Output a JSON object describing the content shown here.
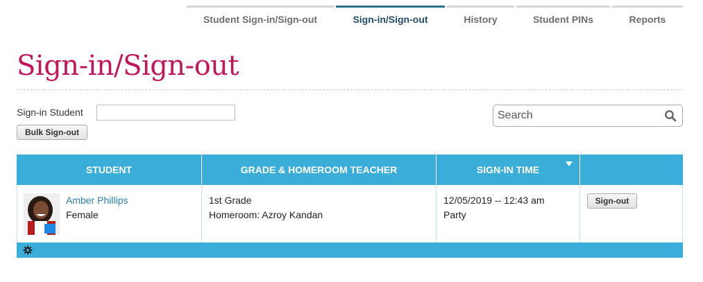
{
  "tabs": [
    {
      "label": "Student Sign-in/Sign-out",
      "active": false
    },
    {
      "label": "Sign-in/Sign-out",
      "active": true
    },
    {
      "label": "History",
      "active": false
    },
    {
      "label": "Student PINs",
      "active": false
    },
    {
      "label": "Reports",
      "active": false
    }
  ],
  "page": {
    "title": "Sign-in/Sign-out"
  },
  "controls": {
    "signin_label": "Sign-in Student",
    "signin_value": "",
    "bulk_signout_label": "Bulk Sign-out",
    "search_placeholder": "Search"
  },
  "table": {
    "headers": [
      "STUDENT",
      "GRADE & HOMEROOM TEACHER",
      "SIGN-IN TIME",
      ""
    ],
    "sorted_column": "SIGN-IN TIME",
    "rows": [
      {
        "student_name": "Amber Phillips",
        "gender": "Female",
        "grade": "1st Grade",
        "homeroom": "Homeroom: Azroy Kandan",
        "signin_time": "12/05/2019 -- 12:43 am",
        "reason": "Party",
        "action_label": "Sign-out"
      }
    ]
  },
  "colors": {
    "accent": "#3aaed8",
    "title": "#c2185b",
    "active_tab": "#2b6f88",
    "link": "#2a7fae"
  },
  "icons": {
    "search": "search-icon",
    "settings": "gear-icon",
    "sort": "sort-desc-icon"
  }
}
